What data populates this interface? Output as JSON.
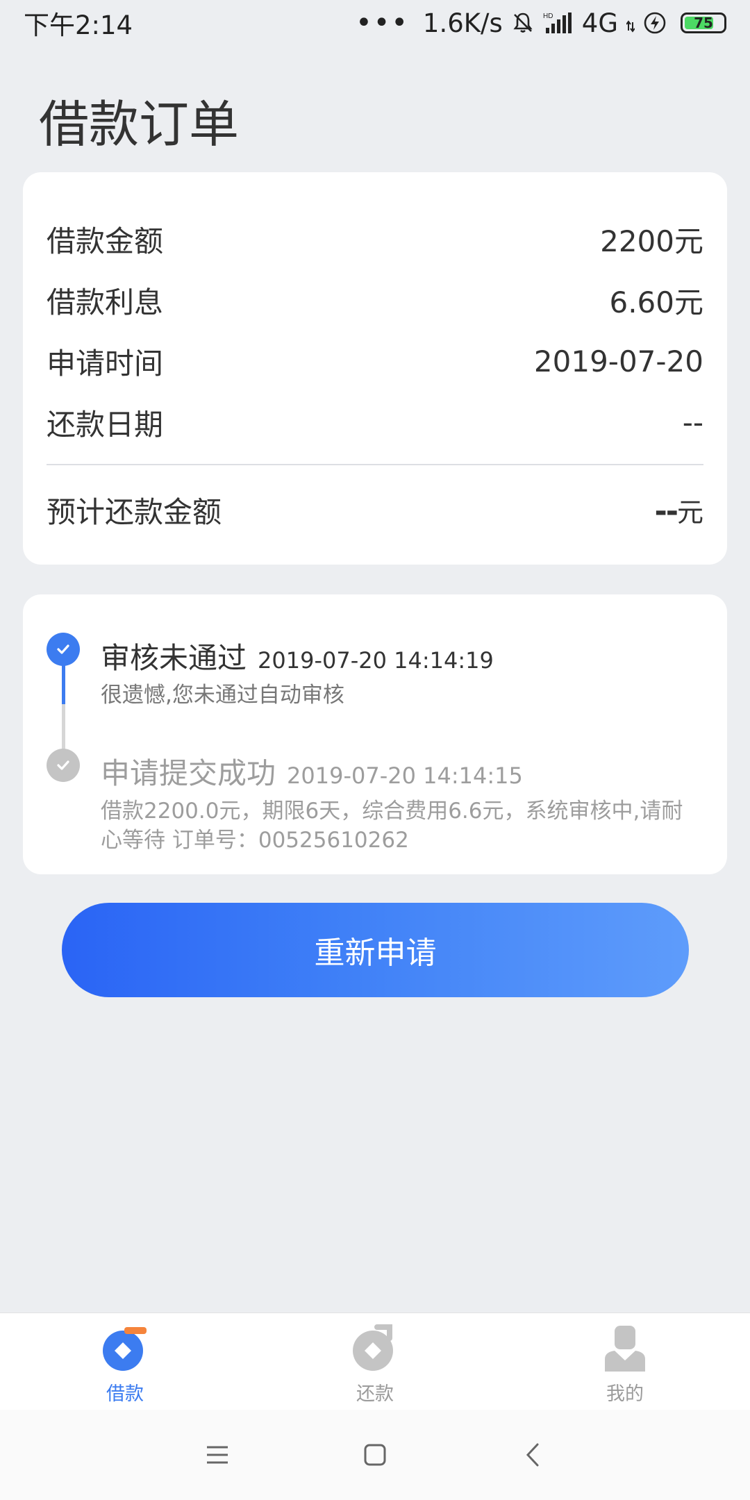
{
  "status_bar": {
    "time": "下午2:14",
    "dots": "•••",
    "network_speed": "1.6K/s",
    "network_type": "4G",
    "battery_level": "75",
    "battery_fraction": 0.75,
    "battery_color": "#4cd964"
  },
  "page": {
    "title": "借款订单"
  },
  "summary": {
    "loan_amount_label": "借款金额",
    "loan_amount_value": "2200元",
    "interest_label": "借款利息",
    "interest_value": "6.60元",
    "apply_time_label": "申请时间",
    "apply_time_value": "2019-07-20",
    "repay_date_label": "还款日期",
    "repay_date_value": "--",
    "expected_repay_label": "预计还款金额",
    "expected_repay_value": "--",
    "expected_repay_unit": "元"
  },
  "timeline": [
    {
      "title": "审核未通过",
      "time": "2019-07-20 14:14:19",
      "desc": "很遗憾,您未通过自动审核",
      "state": "active"
    },
    {
      "title": "申请提交成功",
      "time": "2019-07-20 14:14:15",
      "desc": "借款2200.0元，期限6天，综合费用6.6元，系统审核中,请耐心等待 订单号：00525610262",
      "state": "done"
    }
  ],
  "reapply_button_label": "重新申请",
  "bottom_nav": [
    {
      "label": "借款",
      "icon": "loan-icon",
      "active": true
    },
    {
      "label": "还款",
      "icon": "repay-icon",
      "active": false
    },
    {
      "label": "我的",
      "icon": "profile-icon",
      "active": false
    }
  ],
  "system_nav": {
    "menu_icon": "menu-icon",
    "home_icon": "home-icon",
    "back_icon": "back-icon"
  },
  "colors": {
    "accent": "#3c7cf0",
    "orange_badge": "#f5843b",
    "inactive_gray": "#c4c4c4",
    "background": "#eceef1"
  }
}
